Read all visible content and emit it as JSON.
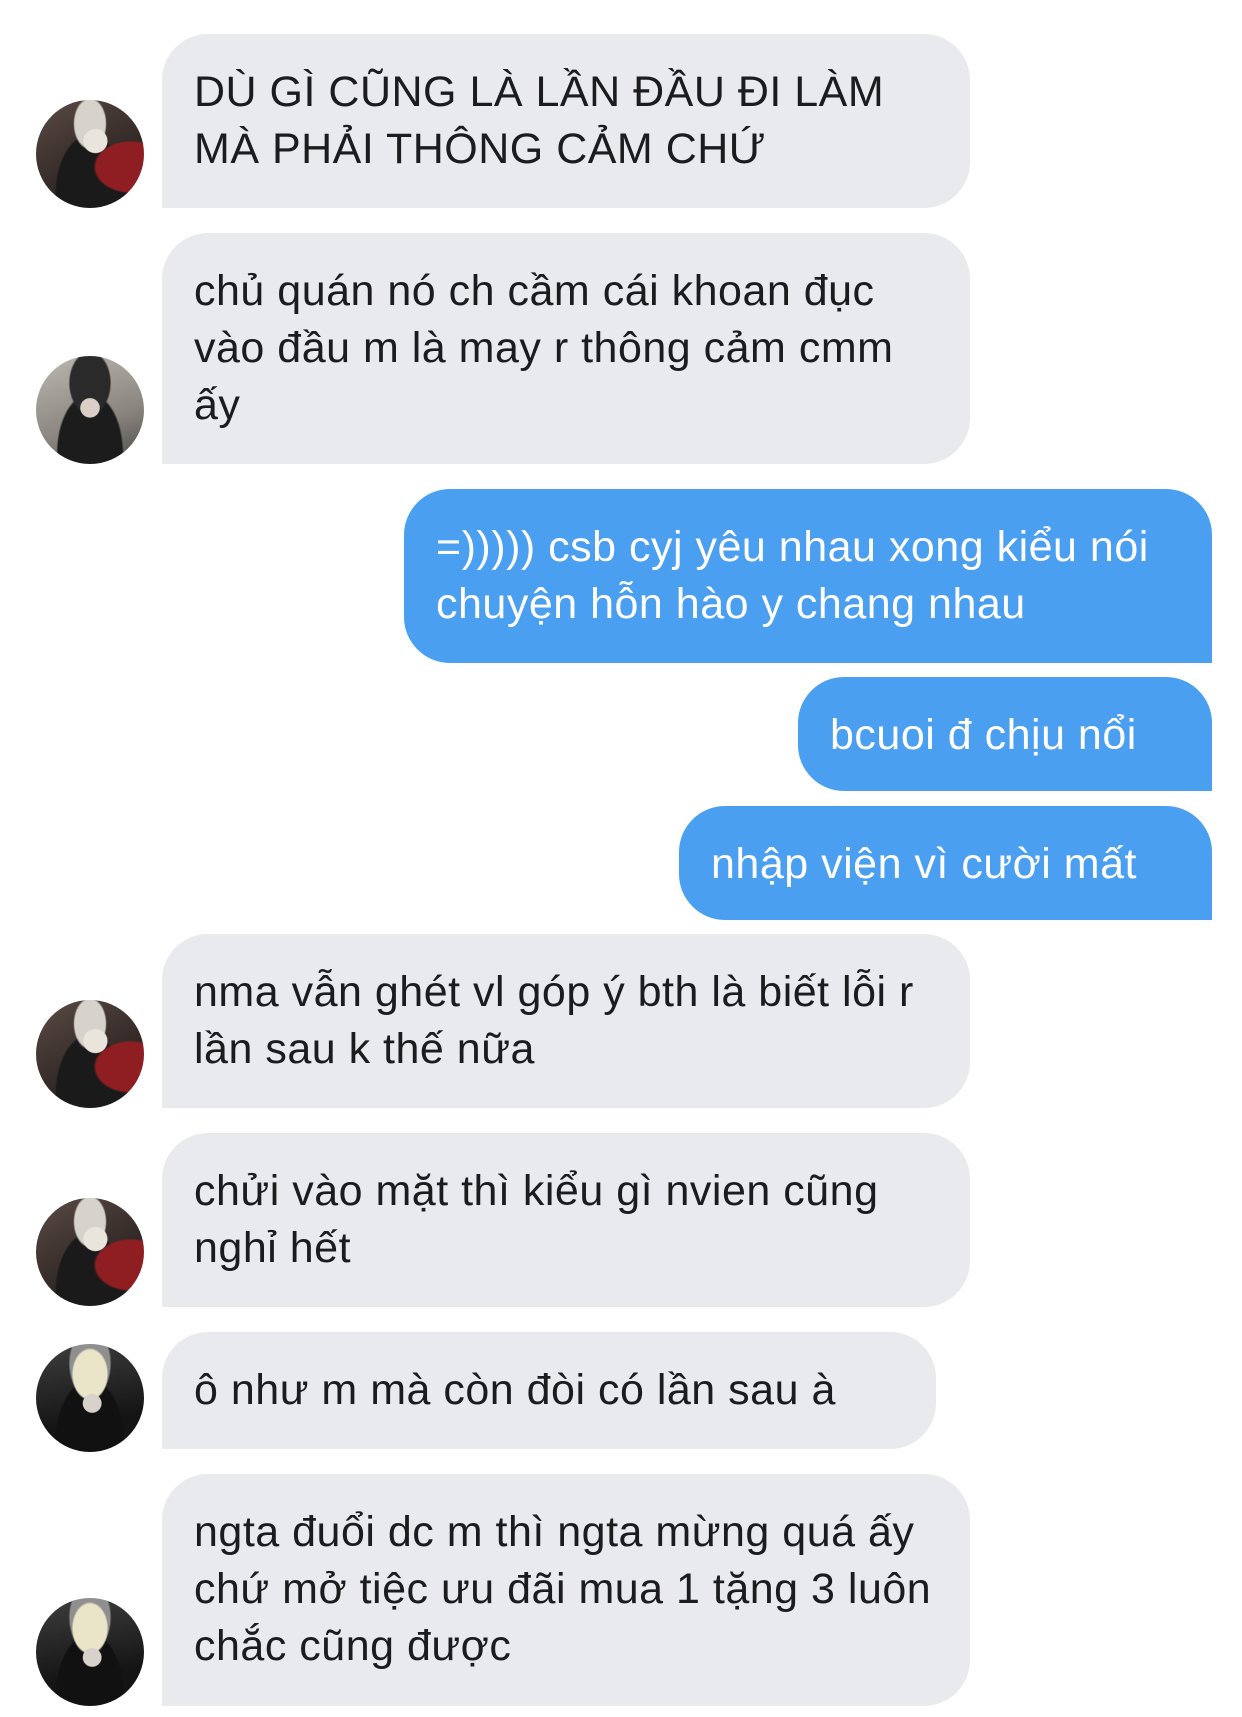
{
  "messages": [
    {
      "side": "in",
      "avatar": "av-a",
      "text": "DÙ GÌ CŨNG LÀ LẦN ĐẦU ĐI LÀM MÀ PHẢI THÔNG CẢM CHỨ"
    },
    {
      "side": "in",
      "avatar": "av-b",
      "text": "chủ quán nó ch cầm cái khoan đục vào đầu m là may r thông cảm cmm ấy"
    },
    {
      "side": "out",
      "text": "=))))) csb cyj yêu nhau xong kiểu nói chuyện hỗn hào y chang nhau"
    },
    {
      "side": "out",
      "text": "bcuoi đ chịu nổi"
    },
    {
      "side": "out",
      "text": "nhập viện vì cười mất"
    },
    {
      "side": "in",
      "avatar": "av-a",
      "text": "nma vẫn ghét vl góp ý bth là biết lỗi r lần sau k thế nữa"
    },
    {
      "side": "in",
      "avatar": "av-a",
      "text": "chửi vào mặt thì kiểu gì nvien cũng nghỉ hết"
    },
    {
      "side": "in",
      "avatar": "av-c",
      "text": "ô như m mà còn đòi có lần sau à"
    },
    {
      "side": "in",
      "avatar": "av-c",
      "text": "ngta đuổi dc m thì ngta mừng quá ấy chứ mở tiệc ưu đãi mua 1 tặng 3 luôn chắc cũng được"
    }
  ],
  "colors": {
    "incoming_bubble": "#e8eaee",
    "outgoing_bubble": "#4a9ff0",
    "incoming_text": "#1c1c1e",
    "outgoing_text": "#ffffff"
  }
}
